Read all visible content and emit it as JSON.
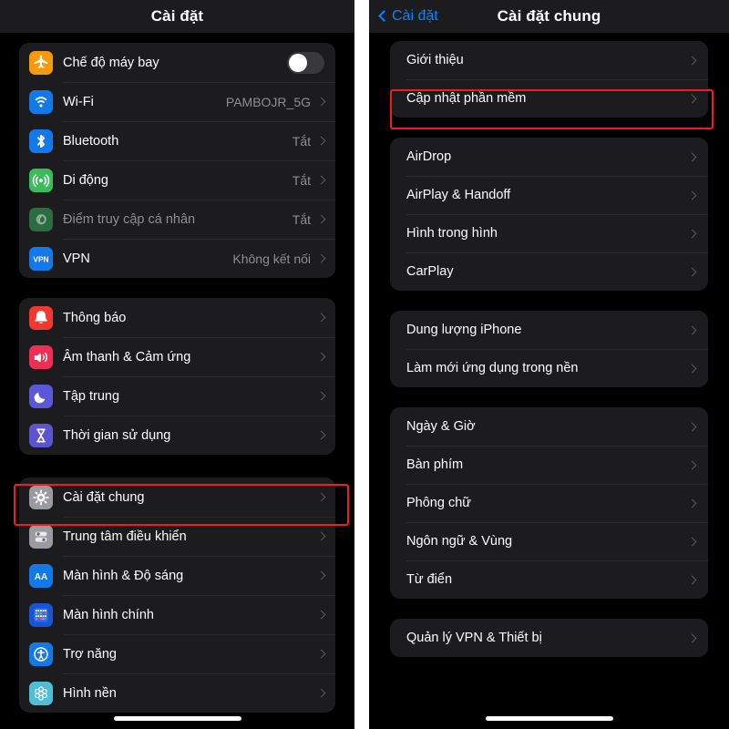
{
  "left_panel": {
    "header": {
      "title": "Cài đặt"
    },
    "groups": [
      {
        "rows": [
          {
            "label": "Chế độ máy bay",
            "icon": "airplane-icon",
            "control": "toggle",
            "toggle_on": false
          },
          {
            "label": "Wi-Fi",
            "icon": "wifi-icon",
            "value": "PAMBOJR_5G"
          },
          {
            "label": "Bluetooth",
            "icon": "bluetooth-icon",
            "value": "Tắt"
          },
          {
            "label": "Di động",
            "icon": "cellular-icon",
            "value": "Tắt"
          },
          {
            "label": "Điểm truy cập cá nhân",
            "icon": "hotspot-icon",
            "value": "Tắt",
            "dimmed": true
          },
          {
            "label": "VPN",
            "icon": "vpn-icon",
            "value": "Không kết nối"
          }
        ]
      },
      {
        "rows": [
          {
            "label": "Thông báo",
            "icon": "bell-icon"
          },
          {
            "label": "Âm thanh & Cảm ứng",
            "icon": "speaker-icon"
          },
          {
            "label": "Tập trung",
            "icon": "moon-icon"
          },
          {
            "label": "Thời gian sử dụng",
            "icon": "hourglass-icon"
          }
        ]
      },
      {
        "rows": [
          {
            "label": "Cài đặt chung",
            "icon": "gear-icon",
            "highlighted": true
          },
          {
            "label": "Trung tâm điều khiển",
            "icon": "control-center-icon"
          },
          {
            "label": "Màn hình & Độ sáng",
            "icon": "display-brightness-icon"
          },
          {
            "label": "Màn hình chính",
            "icon": "home-screen-icon"
          },
          {
            "label": "Trợ năng",
            "icon": "accessibility-icon"
          },
          {
            "label": "Hình nền",
            "icon": "wallpaper-icon"
          }
        ]
      }
    ]
  },
  "right_panel": {
    "header": {
      "back_label": "Cài đặt",
      "title": "Cài đặt chung"
    },
    "groups": [
      {
        "rows": [
          {
            "label": "Giới thiệu"
          },
          {
            "label": "Cập nhật phần mềm",
            "highlighted": true
          }
        ]
      },
      {
        "rows": [
          {
            "label": "AirDrop"
          },
          {
            "label": "AirPlay & Handoff"
          },
          {
            "label": "Hình trong hình"
          },
          {
            "label": "CarPlay"
          }
        ]
      },
      {
        "rows": [
          {
            "label": "Dung lượng iPhone"
          },
          {
            "label": "Làm mới ứng dụng trong nền"
          }
        ]
      },
      {
        "rows": [
          {
            "label": "Ngày & Giờ"
          },
          {
            "label": "Bàn phím"
          },
          {
            "label": "Phông chữ"
          },
          {
            "label": "Ngôn ngữ & Vùng"
          },
          {
            "label": "Từ điển"
          }
        ]
      },
      {
        "rows": [
          {
            "label": "Quản lý VPN & Thiết bị"
          }
        ]
      }
    ]
  },
  "colors": {
    "background": "#000000",
    "card": "#1c1c1e",
    "separator": "#2c2c2e",
    "accent_blue": "#0a84ff",
    "secondary_text": "#8e8e93",
    "highlight_red": "#f01d1d"
  }
}
